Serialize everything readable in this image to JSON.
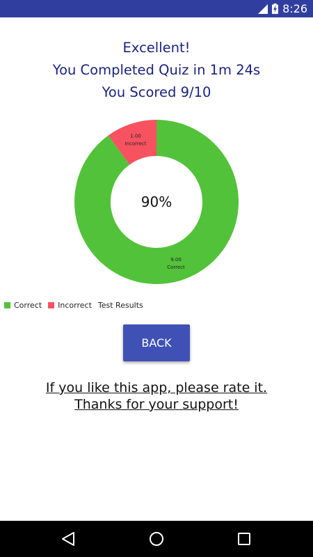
{
  "status_bar": {
    "time": "8:26",
    "color": "#303f9f"
  },
  "result": {
    "line1": "Excellent!",
    "line2": "You Completed Quiz in 1m 24s",
    "line3": "You Scored 9/10",
    "color": "#1a237e"
  },
  "chart_data": {
    "type": "pie",
    "donut": true,
    "center_label": "90%",
    "title": "Test Results",
    "categories": [
      "Correct",
      "Incorrect"
    ],
    "values": [
      9.0,
      1.0
    ],
    "value_labels": [
      "9.00",
      "1.00"
    ],
    "colors": [
      "#52c23a",
      "#f7525f"
    ],
    "legend_position": "bottom-left"
  },
  "back_button": {
    "label": "BACK",
    "color": "#3f51b5"
  },
  "rate_link": {
    "line1": "If you like this app, please rate it.",
    "line2": "Thanks for your support!"
  },
  "nav_bar": {
    "icons": [
      "back-icon",
      "home-icon",
      "recents-icon"
    ]
  }
}
